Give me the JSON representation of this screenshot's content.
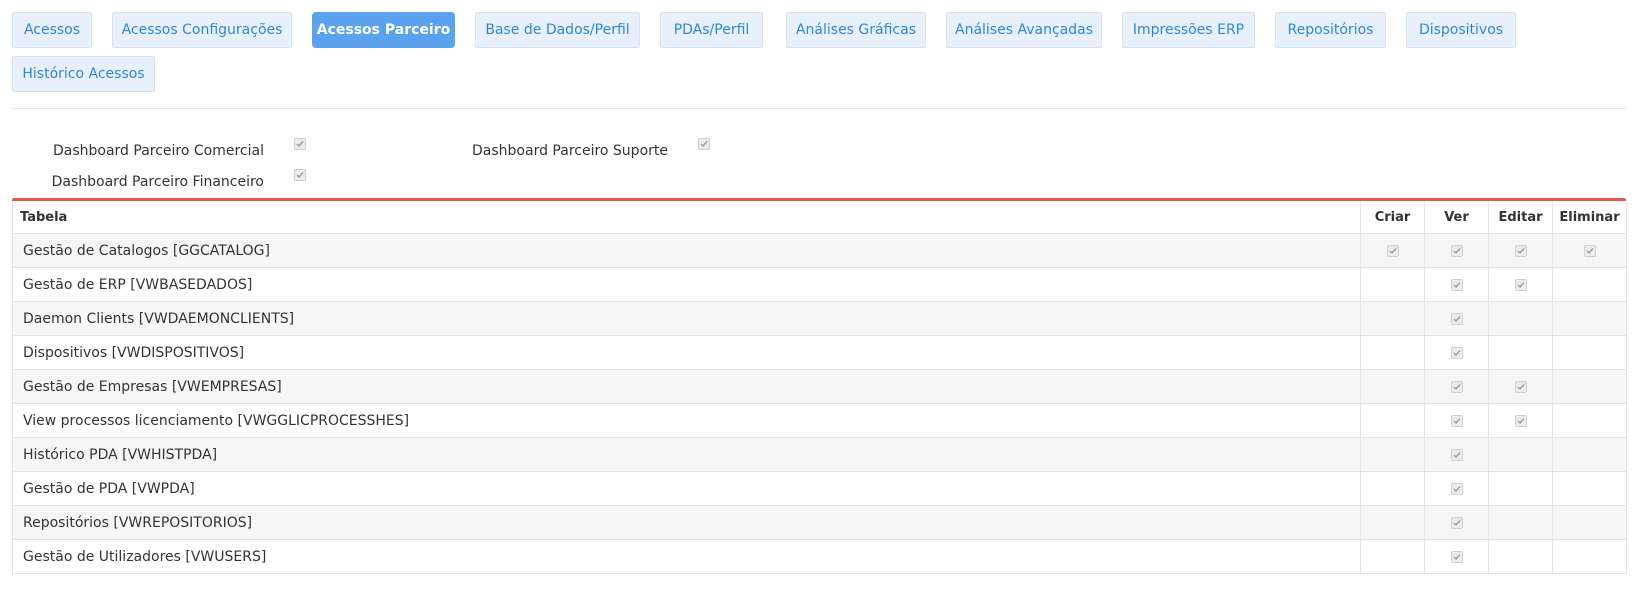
{
  "tabs": [
    {
      "label": "Acessos",
      "active": false
    },
    {
      "label": "Acessos Configurações",
      "active": false
    },
    {
      "label": "Acessos Parceiro",
      "active": true
    },
    {
      "label": "Base de Dados/Perfil",
      "active": false
    },
    {
      "label": "PDAs/Perfil",
      "active": false
    },
    {
      "label": "Análises Gráficas",
      "active": false
    },
    {
      "label": "Análises Avançadas",
      "active": false
    },
    {
      "label": "Impressões ERP",
      "active": false
    },
    {
      "label": "Repositórios",
      "active": false
    },
    {
      "label": "Dispositivos",
      "active": false
    },
    {
      "label": "Histórico Acessos",
      "active": false
    }
  ],
  "options": [
    {
      "label": "Dashboard Parceiro Comercial",
      "checked": true
    },
    {
      "label": "Dashboard Parceiro Suporte",
      "checked": true
    },
    {
      "label": "Dashboard Parceiro Financeiro",
      "checked": true
    }
  ],
  "table": {
    "headers": [
      "Tabela",
      "Criar",
      "Ver",
      "Editar",
      "Eliminar"
    ],
    "rows": [
      {
        "name": "Gestão de Catalogos [GGCATALOG]",
        "criar": true,
        "ver": true,
        "editar": true,
        "eliminar": true
      },
      {
        "name": "Gestão de ERP [VWBASEDADOS]",
        "criar": false,
        "ver": true,
        "editar": true,
        "eliminar": false
      },
      {
        "name": "Daemon Clients [VWDAEMONCLIENTS]",
        "criar": false,
        "ver": true,
        "editar": false,
        "eliminar": false
      },
      {
        "name": "Dispositivos [VWDISPOSITIVOS]",
        "criar": false,
        "ver": true,
        "editar": false,
        "eliminar": false
      },
      {
        "name": "Gestão de Empresas [VWEMPRESAS]",
        "criar": false,
        "ver": true,
        "editar": true,
        "eliminar": false
      },
      {
        "name": "View processos licenciamento [VWGGLICPROCESSHES]",
        "criar": false,
        "ver": true,
        "editar": true,
        "eliminar": false
      },
      {
        "name": "Histórico PDA [VWHISTPDA]",
        "criar": false,
        "ver": true,
        "editar": false,
        "eliminar": false
      },
      {
        "name": "Gestão de PDA [VWPDA]",
        "criar": false,
        "ver": true,
        "editar": false,
        "eliminar": false
      },
      {
        "name": "Repositórios [VWREPOSITORIOS]",
        "criar": false,
        "ver": true,
        "editar": false,
        "eliminar": false
      },
      {
        "name": "Gestão de Utilizadores [VWUSERS]",
        "criar": false,
        "ver": true,
        "editar": false,
        "eliminar": false
      }
    ]
  },
  "colors": {
    "tab_bg": "#e8f1fb",
    "tab_text": "#2f86d6",
    "tab_active_bg": "#5aa2ee",
    "accent_border": "#e8584a"
  }
}
